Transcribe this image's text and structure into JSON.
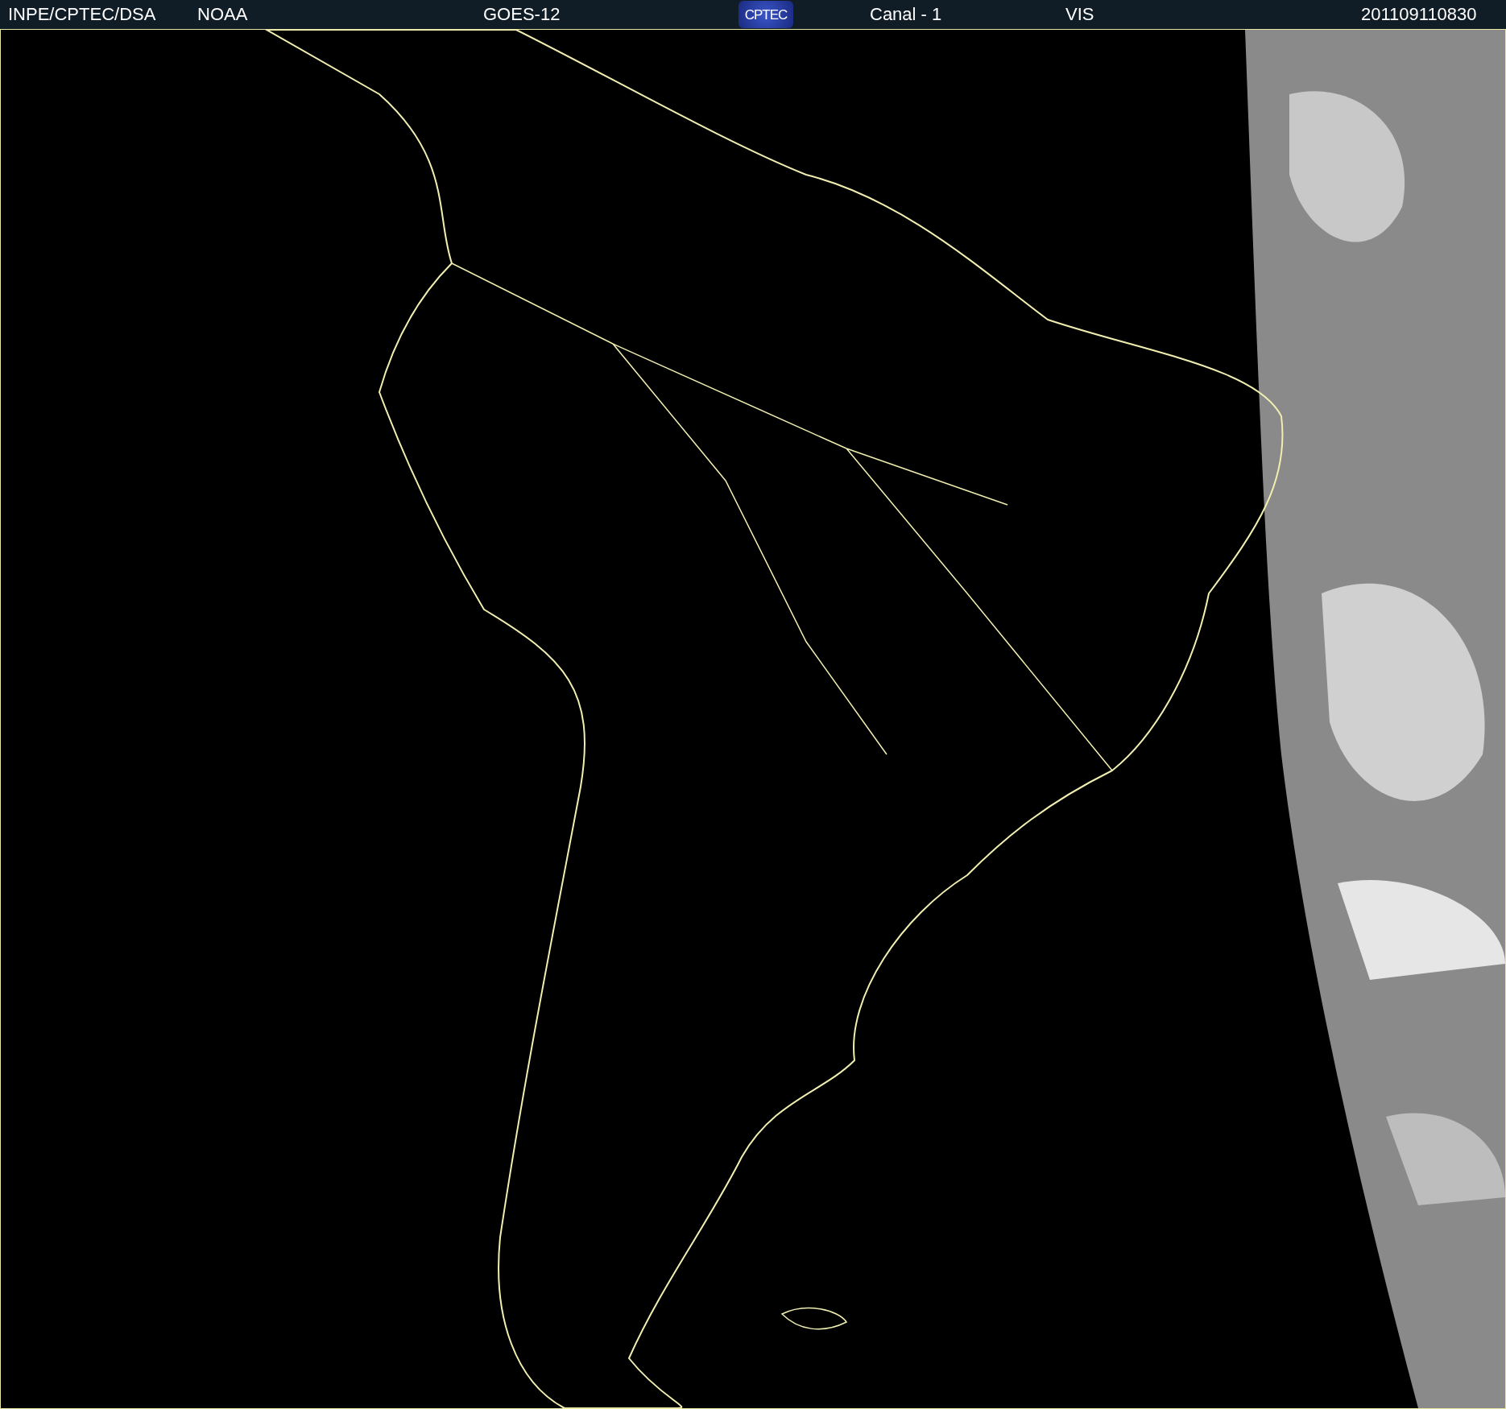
{
  "header": {
    "source": "INPE/CPTEC/DSA",
    "agency": "NOAA",
    "satellite": "GOES-12",
    "logo_text": "CPTEC",
    "channel": "Canal - 1",
    "band": "VIS",
    "timestamp": "201109110830"
  }
}
